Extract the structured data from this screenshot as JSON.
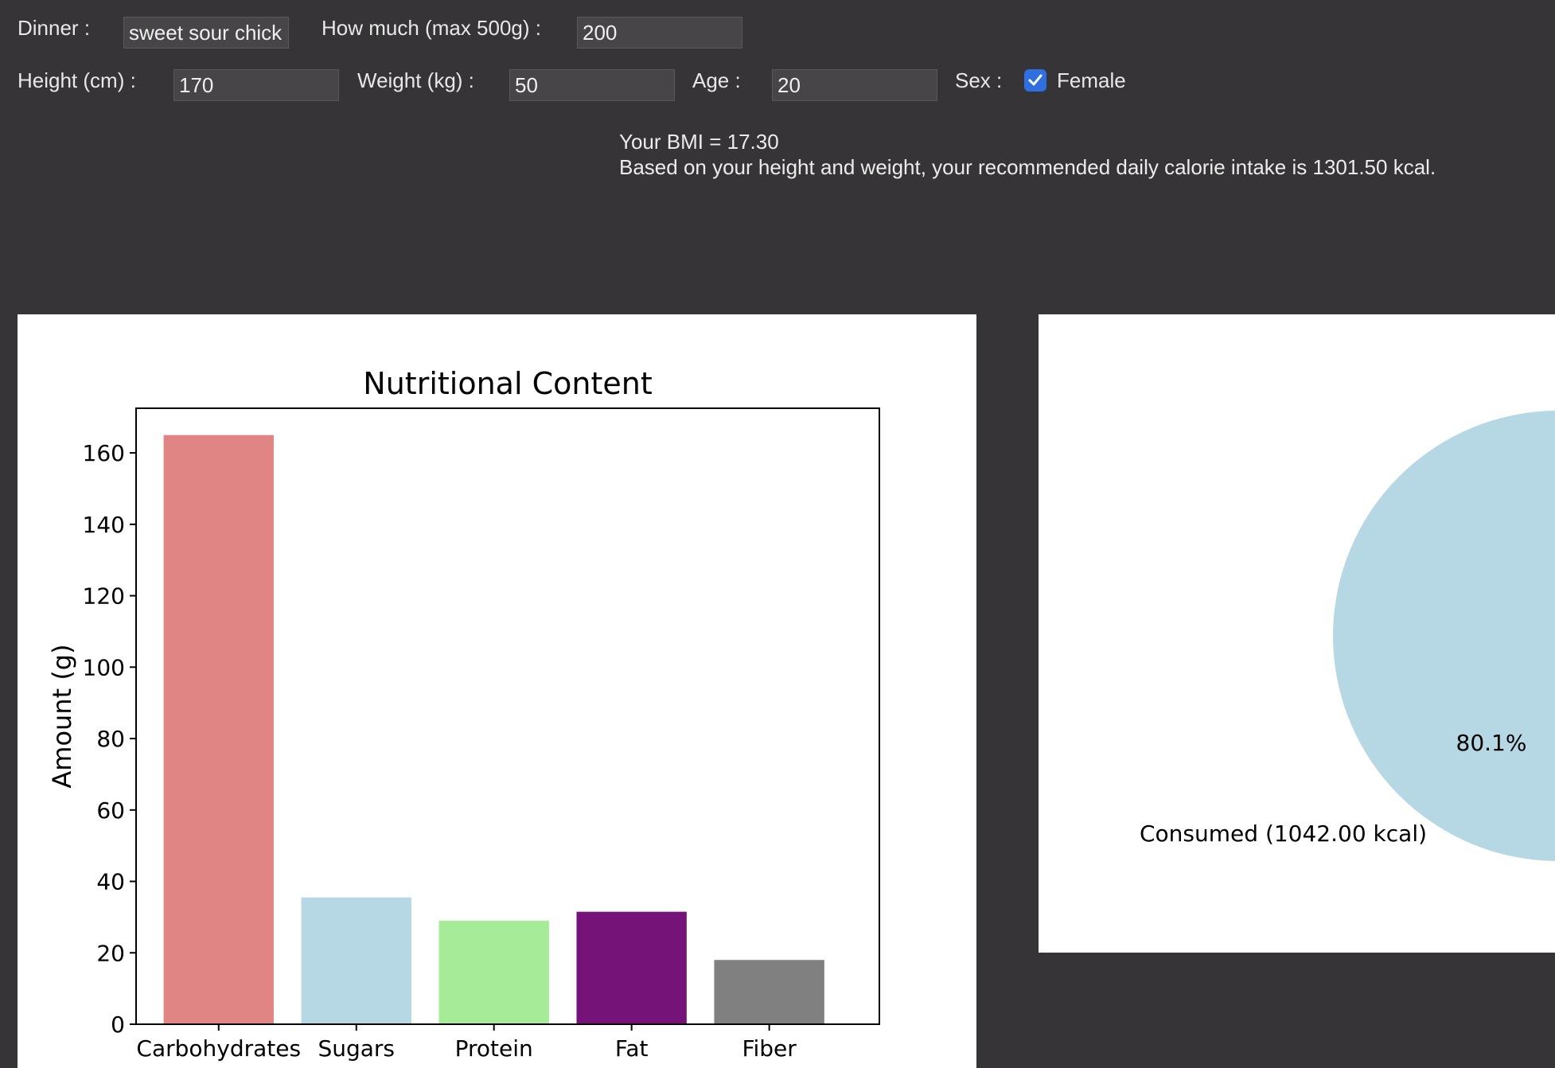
{
  "form": {
    "dinner_label": "Dinner :",
    "dinner_value": "sweet sour chick",
    "howmuch_label": "How much (max 500g) :",
    "howmuch_value": "200",
    "height_label": "Height (cm) :",
    "height_value": "170",
    "weight_label": "Weight (kg) :",
    "weight_value": "50",
    "age_label": "Age :",
    "age_value": "20",
    "sex_label": "Sex :",
    "female_label": "Female",
    "female_checked": true
  },
  "results": {
    "bmi_line": "Your BMI = 17.30",
    "calorie_line": "Based on your height and weight, your recommended daily calorie intake is 1301.50 kcal."
  },
  "chart_data": [
    {
      "type": "bar",
      "title": "Nutritional Content",
      "xlabel": "",
      "ylabel": "Amount (g)",
      "categories": [
        "Carbohydrates",
        "Sugars",
        "Protein",
        "Fat",
        "Fiber"
      ],
      "values": [
        165,
        35.5,
        29,
        31.5,
        18
      ],
      "colors": [
        "#e08583",
        "#b5d8e4",
        "#a5eb98",
        "#751379",
        "#808080"
      ],
      "ylim": [
        0,
        172.5
      ],
      "yticks": [
        0,
        20,
        40,
        60,
        80,
        100,
        120,
        140,
        160
      ],
      "ytick_labels": [
        "0",
        "20",
        "40",
        "60",
        "80",
        "100",
        "120",
        "140",
        "160"
      ],
      "grid": false
    },
    {
      "type": "pie",
      "slices": [
        {
          "label": "Consumed (1042.00 kcal)",
          "percent_label": "80.1%",
          "value": 80.1,
          "color": "#b5d8e4"
        }
      ]
    }
  ]
}
